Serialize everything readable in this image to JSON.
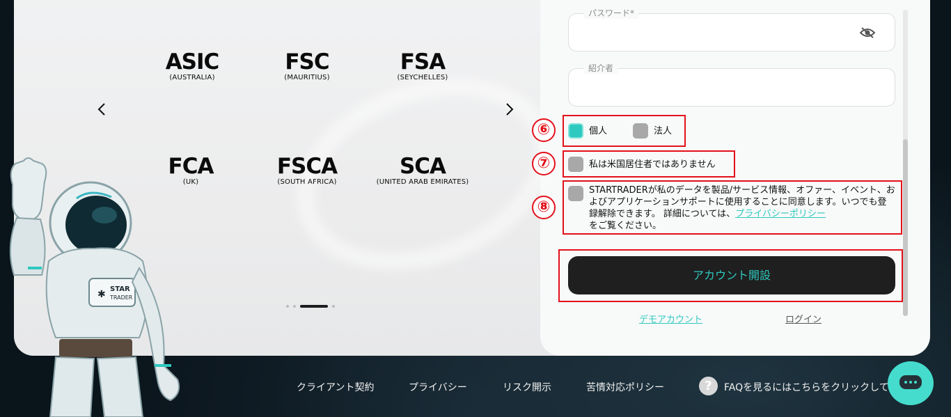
{
  "carousel": {
    "regulators": [
      {
        "code": "ASIC",
        "region": "(AUSTRALIA)"
      },
      {
        "code": "FSC",
        "region": "(MAURITIUS)"
      },
      {
        "code": "FSA",
        "region": "(SEYCHELLES)"
      },
      {
        "code": "FCA",
        "region": "(UK)"
      },
      {
        "code": "FSCA",
        "region": "(SOUTH AFRICA)"
      },
      {
        "code": "SCA",
        "region": "(UNITED ARAB EMIRATES)"
      }
    ],
    "prev_icon": "chevron-left-icon",
    "next_icon": "chevron-right-icon",
    "pages": 4,
    "active_page": 3
  },
  "form": {
    "password_label": "パスワード*",
    "referrer_label": "紹介者",
    "account_types": [
      {
        "label": "個人",
        "checked": true
      },
      {
        "label": "法人",
        "checked": false
      }
    ],
    "us_resident_label": "私は米国居住者ではありません",
    "consent_text": "STARTRADERが私のデータを製品/サービス情報、オファー、イベント、およびアプリケーションサポートに使用することに同意します。いつでも登録解除できます。 詳細については、",
    "privacy_link": "プライバシーポリシー",
    "consent_suffix": "をご覧ください。",
    "submit_label": "アカウント開設",
    "demo_link": "デモアカウント",
    "login_link": "ログイン"
  },
  "annotations": [
    "⑥",
    "⑦",
    "⑧"
  ],
  "astronaut": {
    "badge_line1": "STAR",
    "badge_line2": "TRADER"
  },
  "footer": {
    "links": [
      "クライアント契約",
      "プライバシー",
      "リスク開示",
      "苦情対応ポリシー"
    ],
    "faq": "FAQを見るにはこちらをクリックして"
  },
  "colors": {
    "accent": "#2ec9bf",
    "annotation": "#e3101a",
    "button": "#1f1f1f"
  }
}
